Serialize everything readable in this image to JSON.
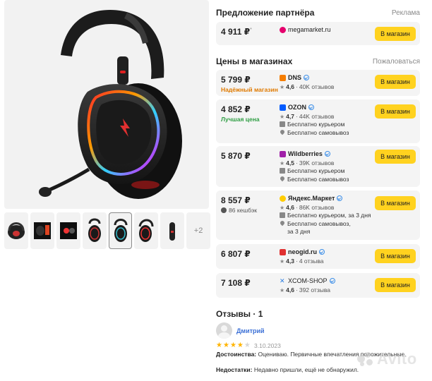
{
  "gallery": {
    "more_label": "+2"
  },
  "partner": {
    "title": "Предложение партнёра",
    "ad_label": "Реклама",
    "price": "4 911 ₽",
    "price_note": "*",
    "shop": "megamarket.ru",
    "button": "В магазин"
  },
  "stores": {
    "title": "Цены в магазинах",
    "complain": "Пожаловаться",
    "offers": [
      {
        "price": "5 799 ₽",
        "tag": "Надёжный магазин",
        "shop": "DNS",
        "logo_color": "#f57d00",
        "rating": "4,6",
        "reviews": "40K отзывов",
        "lines": [],
        "button": "В магазин"
      },
      {
        "price": "4 852 ₽",
        "tag": "Лучшая цена",
        "shop": "OZON",
        "logo_color": "#005bff",
        "rating": "4,7",
        "reviews": "44K отзывов",
        "lines": [
          "Бесплатно курьером",
          "Бесплатно самовывоз"
        ],
        "button": "В магазин"
      },
      {
        "price": "5 870 ₽",
        "tag": "",
        "shop": "Wildberries",
        "logo_color": "#a020a8",
        "rating": "4,5",
        "reviews": "39K отзывов",
        "lines": [
          "Бесплатно курьером",
          "Бесплатно самовывоз"
        ],
        "button": "В магазин"
      },
      {
        "price": "8 557 ₽",
        "tag": "86 кешбэк",
        "shop": "Яндекс.Маркет",
        "logo_color": "#222222",
        "rating": "4,6",
        "reviews": "86K отзывов",
        "lines": [
          "Бесплатно курьером, за 3 дня",
          "Бесплатно самовывоз,",
          "за 3 дня"
        ],
        "button": "В магазин"
      },
      {
        "price": "6 807 ₽",
        "tag": "",
        "shop": "neogid.ru",
        "logo_color": "#e03030",
        "rating": "4,3",
        "reviews": "4 отзыва",
        "lines": [],
        "button": "В магазин"
      },
      {
        "price": "7 108 ₽",
        "tag": "",
        "shop": "XCOM-SHOP",
        "logo_color": "#2a7de1",
        "rating": "4,6",
        "reviews": "392 отзыва",
        "lines": [],
        "button": "В магазин"
      }
    ]
  },
  "reviews": {
    "title": "Отзывы · 1",
    "author": "Дмитрий",
    "stars": 4,
    "date": "3.10.2023",
    "pros_label": "Достоинства:",
    "pros": "Оцениваю. Первичные впечатления положительные.",
    "cons_label": "Недостатки:",
    "cons": "Недавно пришли, ещё не обнаружил."
  },
  "watermark": "Avito",
  "colors": {
    "button": "#ffd21f",
    "card_bg": "#f4f4f4",
    "reliable_tag": "#e07a00",
    "best_price_tag": "#2f9e44",
    "link": "#3a6fd6",
    "star": "#ffb400"
  }
}
